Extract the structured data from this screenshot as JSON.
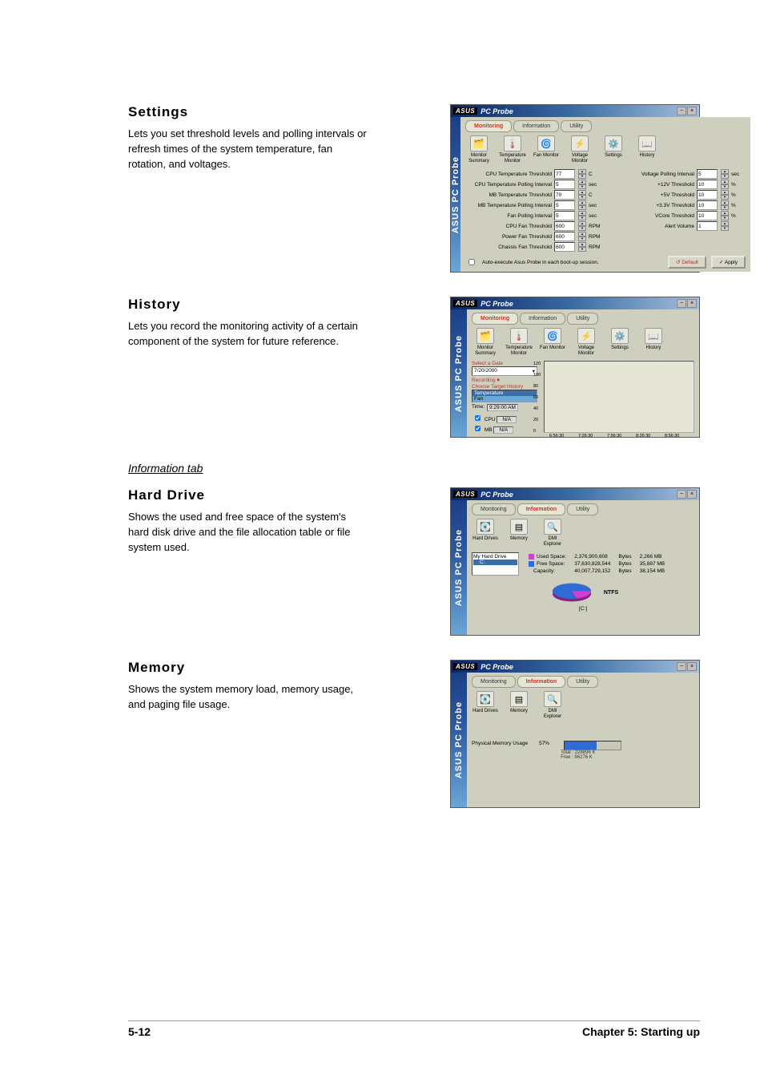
{
  "page": {
    "number": "5-12",
    "chapter": "Chapter 5: Starting up"
  },
  "sections": {
    "settings": {
      "heading": "Settings",
      "body": "Lets you set threshold levels and polling intervals or refresh times of the system temperature, fan rotation, and voltages."
    },
    "history": {
      "heading": "History",
      "body": "Lets you record the monitoring activity of a certain component of the system for future reference."
    },
    "info_tab": "Information tab",
    "harddrive": {
      "heading": "Hard Drive",
      "body": "Shows the used and free space of the system's hard disk drive and the file allocation table or file system used."
    },
    "memory": {
      "heading": "Memory",
      "body": "Shows the system memory load, memory usage, and paging file usage."
    }
  },
  "app": {
    "brand": "ASUS",
    "title": "PC Probe",
    "sidebar": "ASUS PC Probe",
    "win_min": "−",
    "win_close": "×",
    "tabs": {
      "monitoring": "Monitoring",
      "information": "Information",
      "utility": "Utility"
    },
    "mon_icons": {
      "summary": "Monitor Summary",
      "temp": "Temperature Monitor",
      "fan": "Fan Monitor",
      "volt": "Voltage Monitor",
      "settings": "Settings",
      "history": "History"
    },
    "info_icons": {
      "hd": "Hard Drives",
      "mem": "Memory",
      "dmi": "DMI Explorer"
    }
  },
  "settings_ss": {
    "left": [
      {
        "k": "CPU Temperature Threshold",
        "v": "77",
        "u": "C"
      },
      {
        "k": "CPU Temperature Polling Interval",
        "v": "5",
        "u": "sec"
      },
      {
        "k": "MB Temperature Threshold",
        "v": "70",
        "u": "C"
      },
      {
        "k": "MB Temperature Polling Interval",
        "v": "5",
        "u": "sec"
      },
      {
        "k": "Fan Polling Interval",
        "v": "5",
        "u": "sec"
      },
      {
        "k": "CPU Fan Threshold",
        "v": "600",
        "u": "RPM"
      },
      {
        "k": "Power Fan Threshold",
        "v": "600",
        "u": "RPM"
      },
      {
        "k": "Chassis Fan Threshold",
        "v": "600",
        "u": "RPM"
      }
    ],
    "right": [
      {
        "k": "Voltage Polling Interval",
        "v": "5",
        "u": "sec"
      },
      {
        "k": "+12V Threshold",
        "v": "10",
        "u": "%"
      },
      {
        "k": "+5V Threshold",
        "v": "10",
        "u": "%"
      },
      {
        "k": "+3.3V Threshold",
        "v": "10",
        "u": "%"
      },
      {
        "k": "VCore Threshold",
        "v": "10",
        "u": "%"
      },
      {
        "k": "Alert Volume",
        "v": "1",
        "u": ""
      }
    ],
    "auto": "Auto-execute Asus Probe in each boot-up session.",
    "btn_default": "Default",
    "btn_apply": "Apply"
  },
  "history_ss": {
    "select_date": "Select a Date",
    "date": "7/20/2000",
    "recording": "Recording",
    "choose": "Choose Target History",
    "targets": [
      "Temperature",
      "Fan"
    ],
    "time_lbl": "Time:",
    "time_val": "9:29:00 AM",
    "cpu": "CPU",
    "mb": "MB",
    "na": "N/A",
    "yticks": [
      "120",
      "100",
      "80",
      "60",
      "40",
      "20",
      "0"
    ],
    "xticks": [
      "6:56:30",
      "7:26:30",
      "7:56:30",
      "8:26:30",
      "8:56:30"
    ]
  },
  "hd_ss": {
    "list": [
      "My Hard Drive",
      "C:"
    ],
    "used_lbl": "Used Space:",
    "free_lbl": "Free Space:",
    "cap_lbl": "Capacity:",
    "used_b": "2,376,900,608",
    "used_mb": "2,266 MB",
    "free_b": "37,630,828,544",
    "free_mb": "35,887 MB",
    "cap_b": "40,007,729,152",
    "cap_mb": "38,154 MB",
    "bytes": "Bytes",
    "fs": "NTFS",
    "pie_lbl": "[C:]",
    "used_color": "#d63bd6",
    "free_color": "#2e6bd6"
  },
  "mem_ss": {
    "label": "Physical Memory Usage",
    "pct": "57%",
    "total": "Total : 228896 K",
    "free": "Free  : 96276 K"
  }
}
